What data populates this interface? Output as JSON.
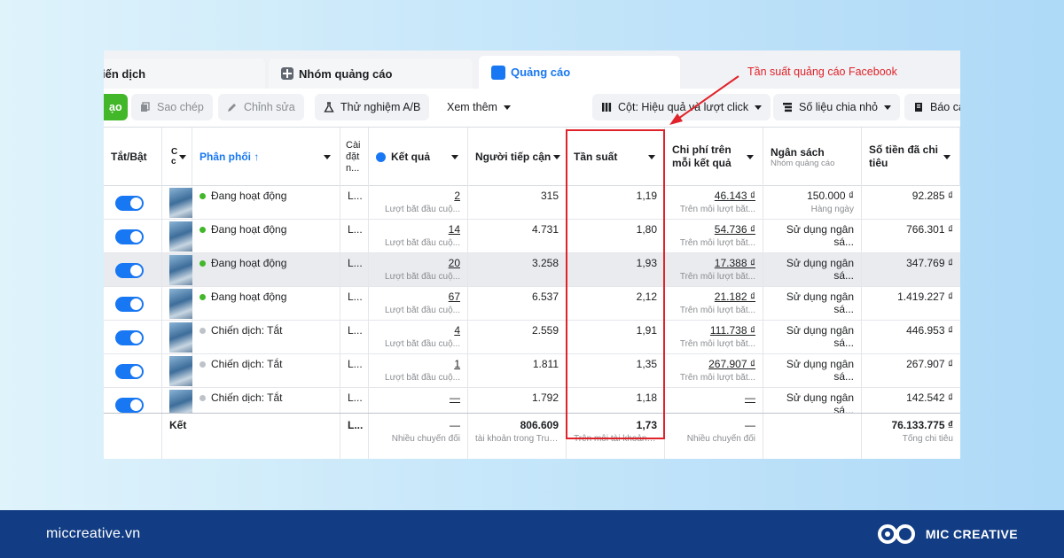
{
  "annotation": {
    "note": "Tần suất quảng cáo Facebook",
    "color": "#e0232a"
  },
  "tabs": [
    {
      "label": "iến dịch"
    },
    {
      "label": "Nhóm quảng cáo"
    },
    {
      "label": "Quảng cáo"
    }
  ],
  "toolbar": {
    "create": "ạo",
    "copy": "Sao chép",
    "edit": "Chỉnh sửa",
    "ab_test": "Thử nghiệm A/B",
    "more": "Xem thêm",
    "columns": "Cột: Hiệu quả và lượt click",
    "breakdown": "Số liệu chia nhỏ",
    "reports": "Báo cá"
  },
  "columns": {
    "toggle": "Tắt/Bật",
    "c": "C\nc",
    "delivery": "Phân phối ↑",
    "setting": "Cài đặt n...",
    "results": "Kết quả",
    "reach": "Người tiếp cận",
    "frequency": "Tần suất",
    "cpr": "Chi phí trên mỗi kết quả",
    "budget": "Ngân sách",
    "budget_sub": "Nhóm quảng cáo",
    "spent": "Số tiền đã chi tiêu"
  },
  "rows": [
    {
      "status": "Đang hoạt động",
      "status_color": "#42b72a",
      "setting": "L...",
      "result": "2",
      "result_sub": "Lượt bắt đầu cuộ...",
      "reach": "315",
      "frequency": "1,19",
      "cpr": "46.143 ₫",
      "cpr_sub": "Trên mỗi lượt bắt...",
      "budget": "150.000 ₫",
      "budget_sub": "Hàng ngày",
      "spent": "92.285 ₫"
    },
    {
      "status": "Đang hoạt động",
      "status_color": "#42b72a",
      "setting": "L...",
      "result": "14",
      "result_sub": "Lượt bắt đầu cuộ...",
      "reach": "4.731",
      "frequency": "1,80",
      "cpr": "54.736 ₫",
      "cpr_sub": "Trên mỗi lượt bắt...",
      "budget": "Sử dụng ngân sá...",
      "budget_sub": "",
      "spent": "766.301 ₫"
    },
    {
      "status": "Đang hoạt động",
      "status_color": "#42b72a",
      "setting": "L...",
      "result": "20",
      "result_sub": "Lượt bắt đầu cuộ...",
      "reach": "3.258",
      "frequency": "1,93",
      "cpr": "17.388 ₫",
      "cpr_sub": "Trên mỗi lượt bắt...",
      "budget": "Sử dụng ngân sá...",
      "budget_sub": "",
      "spent": "347.769 ₫"
    },
    {
      "status": "Đang hoạt động",
      "status_color": "#42b72a",
      "setting": "L...",
      "result": "67",
      "result_sub": "Lượt bắt đầu cuộ...",
      "reach": "6.537",
      "frequency": "2,12",
      "cpr": "21.182 ₫",
      "cpr_sub": "Trên mỗi lượt bắt...",
      "budget": "Sử dụng ngân sá...",
      "budget_sub": "",
      "spent": "1.419.227 ₫"
    },
    {
      "status": "Chiến dịch: Tắt",
      "status_color": "#bec3c9",
      "setting": "L...",
      "result": "4",
      "result_sub": "Lượt bắt đầu cuộ...",
      "reach": "2.559",
      "frequency": "1,91",
      "cpr": "111.738 ₫",
      "cpr_sub": "Trên mỗi lượt bắt...",
      "budget": "Sử dụng ngân sá...",
      "budget_sub": "",
      "spent": "446.953 ₫"
    },
    {
      "status": "Chiến dịch: Tắt",
      "status_color": "#bec3c9",
      "setting": "L...",
      "result": "1",
      "result_sub": "Lượt bắt đầu cuộ...",
      "reach": "1.811",
      "frequency": "1,35",
      "cpr": "267.907 ₫",
      "cpr_sub": "Trên mỗi lượt bắt...",
      "budget": "Sử dụng ngân sá...",
      "budget_sub": "",
      "spent": "267.907 ₫"
    },
    {
      "status": "Chiến dịch: Tắt",
      "status_color": "#bec3c9",
      "setting": "L...",
      "result": "—",
      "result_sub": "",
      "reach": "1.792",
      "frequency": "1,18",
      "cpr": "—",
      "cpr_sub": "",
      "budget": "Sử dụng ngân sá...",
      "budget_sub": "",
      "spent": "142.542 ₫"
    }
  ],
  "footer_row": {
    "label": "Kết",
    "setting": "L...",
    "result": "—",
    "result_sub": "Nhiều chuyển đổi",
    "reach": "806.609",
    "reach_sub": "tài khoản trong Trun...",
    "frequency": "1,73",
    "frequency_sub": "Trên mỗi tài khoản t...",
    "cpr": "—",
    "cpr_sub": "Nhiều chuyển đổi",
    "spent": "76.133.775 ₫",
    "spent_sub": "Tổng chi tiêu"
  },
  "brand": {
    "site": "miccreative.vn",
    "name": "MIC CREATIVE",
    "footer_color": "#123d84"
  }
}
